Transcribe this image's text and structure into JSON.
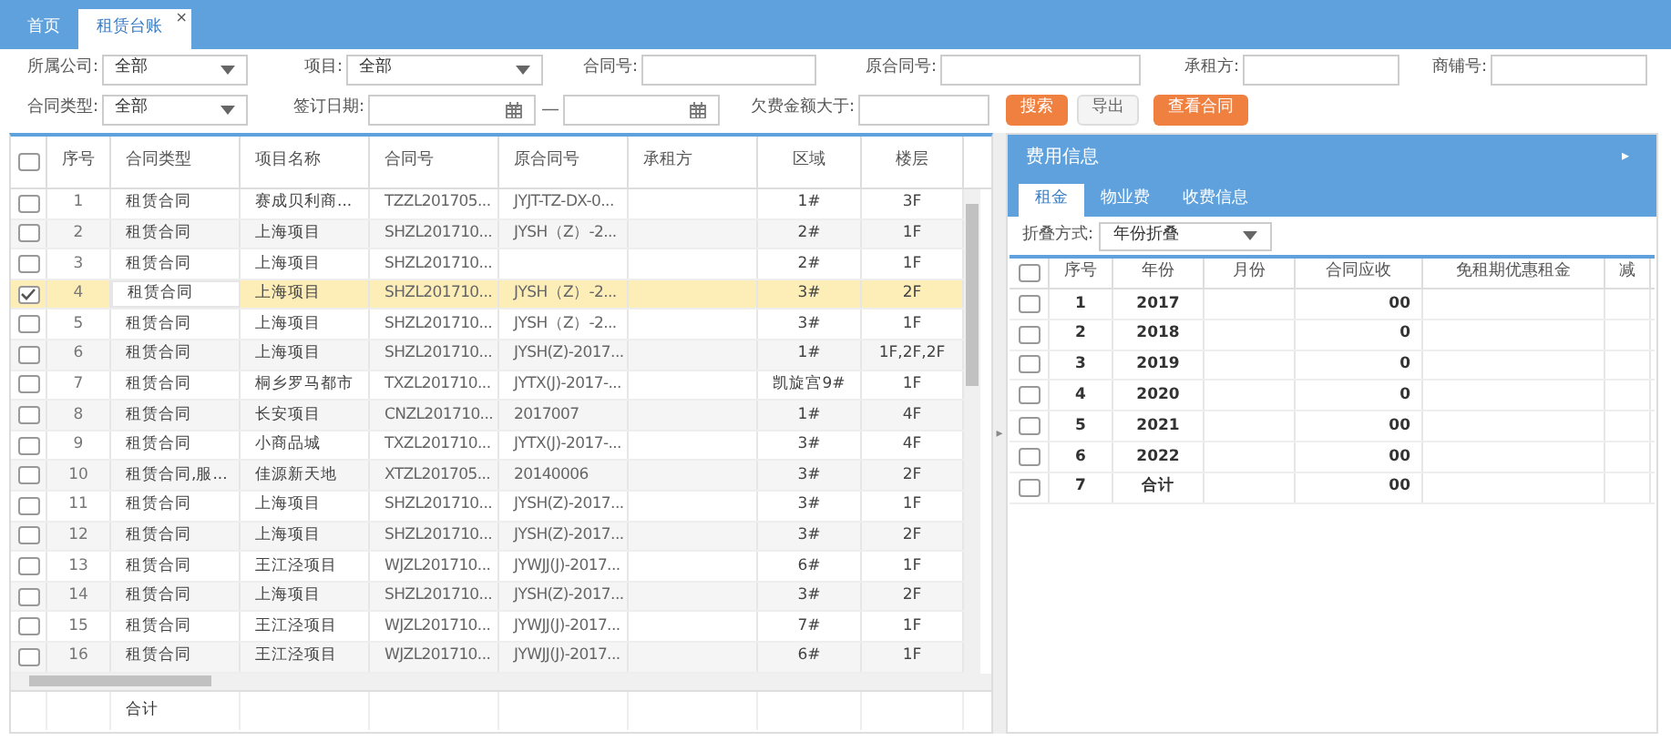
{
  "tabs": [
    {
      "label": "首页",
      "selected": false,
      "closable": false
    },
    {
      "label": "租赁台账",
      "selected": true,
      "closable": true,
      "close_icon": "×"
    }
  ],
  "filters": [
    [
      {
        "kind": "select",
        "label": "所属公司:",
        "value": "全部"
      },
      {
        "kind": "select",
        "label": "项目:",
        "value": "全部"
      },
      {
        "kind": "input",
        "label": "合同号:"
      },
      {
        "kind": "input",
        "label": "原合同号:"
      },
      {
        "kind": "input",
        "label": "承租方:"
      },
      {
        "kind": "input",
        "label": "商铺号:"
      }
    ],
    [
      {
        "kind": "select",
        "label": "合同类型:",
        "value": "全部"
      },
      {
        "kind": "date",
        "label": "签订日期:"
      },
      {
        "kind": "dash",
        "label": "—"
      },
      {
        "kind": "date"
      },
      {
        "kind": "input",
        "label": "欠费金额大于:"
      },
      {
        "kind": "button",
        "label": "搜索",
        "primary": true
      },
      {
        "kind": "button",
        "label": "导出",
        "primary": false
      },
      {
        "kind": "button",
        "label": "查看合同",
        "primary": true
      }
    ]
  ],
  "contracts": {
    "columns": [
      "序号",
      "合同类型",
      "项目名称",
      "合同号",
      "原合同号",
      "承租方",
      "区域",
      "楼层"
    ],
    "rows": [
      {
        "cells": [
          "1",
          "租赁合同",
          "赛成贝利商...",
          "TZZL201705...",
          "JYJT-TZ-DX-0...",
          "",
          "1#",
          "3F"
        ],
        "selected": false
      },
      {
        "cells": [
          "2",
          "租赁合同",
          "上海项目",
          "SHZL201710...",
          "JYSH（Z）-2...",
          "",
          "2#",
          "1F"
        ],
        "selected": false
      },
      {
        "cells": [
          "3",
          "租赁合同",
          "上海项目",
          "SHZL201710...",
          "",
          "",
          "2#",
          "1F"
        ],
        "selected": false
      },
      {
        "cells": [
          "4",
          "租赁合同",
          "上海项目",
          "SHZL201710...",
          "JYSH（Z）-2...",
          "",
          "3#",
          "2F"
        ],
        "selected": true
      },
      {
        "cells": [
          "5",
          "租赁合同",
          "上海项目",
          "SHZL201710...",
          "JYSH（Z）-2...",
          "",
          "3#",
          "1F"
        ],
        "selected": false
      },
      {
        "cells": [
          "6",
          "租赁合同",
          "上海项目",
          "SHZL201710...",
          "JYSH(Z)-2017...",
          "",
          "1#",
          "1F,2F,2F"
        ],
        "selected": false
      },
      {
        "cells": [
          "7",
          "租赁合同",
          "桐乡罗马都市",
          "TXZL201710...",
          "JYTX(J)-2017-...",
          "",
          "凯旋宫9#",
          "1F"
        ],
        "selected": false
      },
      {
        "cells": [
          "8",
          "租赁合同",
          "长安项目",
          "CNZL201710...",
          "2017007",
          "",
          "1#",
          "4F"
        ],
        "selected": false
      },
      {
        "cells": [
          "9",
          "租赁合同",
          "小商品城",
          "TXZL201710...",
          "JYTX(J)-2017-...",
          "",
          "3#",
          "4F"
        ],
        "selected": false
      },
      {
        "cells": [
          "10",
          "租赁合同,服...",
          "佳源新天地",
          "XTZL201705...",
          "20140006",
          "",
          "3#",
          "2F"
        ],
        "selected": false
      },
      {
        "cells": [
          "11",
          "租赁合同",
          "上海项目",
          "SHZL201710...",
          "JYSH(Z)-2017...",
          "",
          "3#",
          "1F"
        ],
        "selected": false
      },
      {
        "cells": [
          "12",
          "租赁合同",
          "上海项目",
          "SHZL201710...",
          "JYSH(Z)-2017...",
          "",
          "3#",
          "2F"
        ],
        "selected": false
      },
      {
        "cells": [
          "13",
          "租赁合同",
          "王江泾项目",
          "WJZL201710...",
          "JYWJJ(J)-2017...",
          "",
          "6#",
          "1F"
        ],
        "selected": false
      },
      {
        "cells": [
          "14",
          "租赁合同",
          "上海项目",
          "SHZL201710...",
          "JYSH(Z)-2017...",
          "",
          "3#",
          "2F"
        ],
        "selected": false
      },
      {
        "cells": [
          "15",
          "租赁合同",
          "王江泾项目",
          "WJZL201710...",
          "JYWJJ(J)-2017...",
          "",
          "7#",
          "1F"
        ],
        "selected": false
      },
      {
        "cells": [
          "16",
          "租赁合同",
          "王江泾项目",
          "WJZL201710...",
          "JYWJJ(J)-2017...",
          "",
          "6#",
          "1F"
        ],
        "selected": false
      }
    ],
    "footer": "合计",
    "all_checked": false
  },
  "fees": {
    "title": "费用信息",
    "expand_icon": "▸",
    "tabs": [
      {
        "label": "租金",
        "selected": true
      },
      {
        "label": "物业费",
        "selected": false
      },
      {
        "label": "收费信息",
        "selected": false
      }
    ],
    "fold": {
      "label": "折叠方式:",
      "value": "年份折叠"
    },
    "all_checked": false,
    "columns": [
      "序号",
      "年份",
      "月份",
      "合同应收",
      "免租期优惠租金",
      "减"
    ],
    "rows": [
      {
        "cells": [
          "1",
          "2017",
          "",
          "00",
          ""
        ],
        "checked": false
      },
      {
        "cells": [
          "2",
          "2018",
          "",
          "0",
          ""
        ],
        "checked": false
      },
      {
        "cells": [
          "3",
          "2019",
          "",
          "0",
          ""
        ],
        "checked": false
      },
      {
        "cells": [
          "4",
          "2020",
          "",
          "0",
          ""
        ],
        "checked": false
      },
      {
        "cells": [
          "5",
          "2021",
          "",
          "00",
          ""
        ],
        "checked": false
      },
      {
        "cells": [
          "6",
          "2022",
          "",
          "00",
          ""
        ],
        "checked": false
      },
      {
        "cells": [
          "7",
          "合计",
          "",
          "00",
          ""
        ],
        "checked": false
      }
    ]
  },
  "collapse_icon": "▸"
}
